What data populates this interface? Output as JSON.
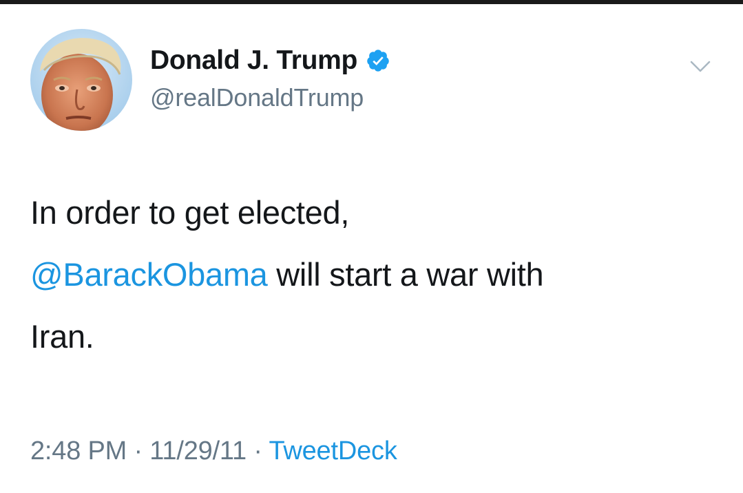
{
  "tweet": {
    "author": {
      "name": "Donald J. Trump",
      "handle": "@realDonaldTrump",
      "verified_icon": "verified-badge-icon",
      "avatar_icon": "profile-photo"
    },
    "menu_icon": "chevron-down-icon",
    "text": {
      "line1": "In order to get elected,",
      "mention": "@BarackObama",
      "line2_rest": " will start a war with",
      "line3": "Iran."
    },
    "meta": {
      "time": "2:48 PM",
      "sep1": " · ",
      "date": "11/29/11",
      "sep2": " · ",
      "source": "TweetDeck"
    }
  },
  "colors": {
    "text": "#14171a",
    "secondary": "#657786",
    "link": "#1b95e0",
    "verified": "#1da1f2",
    "background": "#ffffff"
  }
}
